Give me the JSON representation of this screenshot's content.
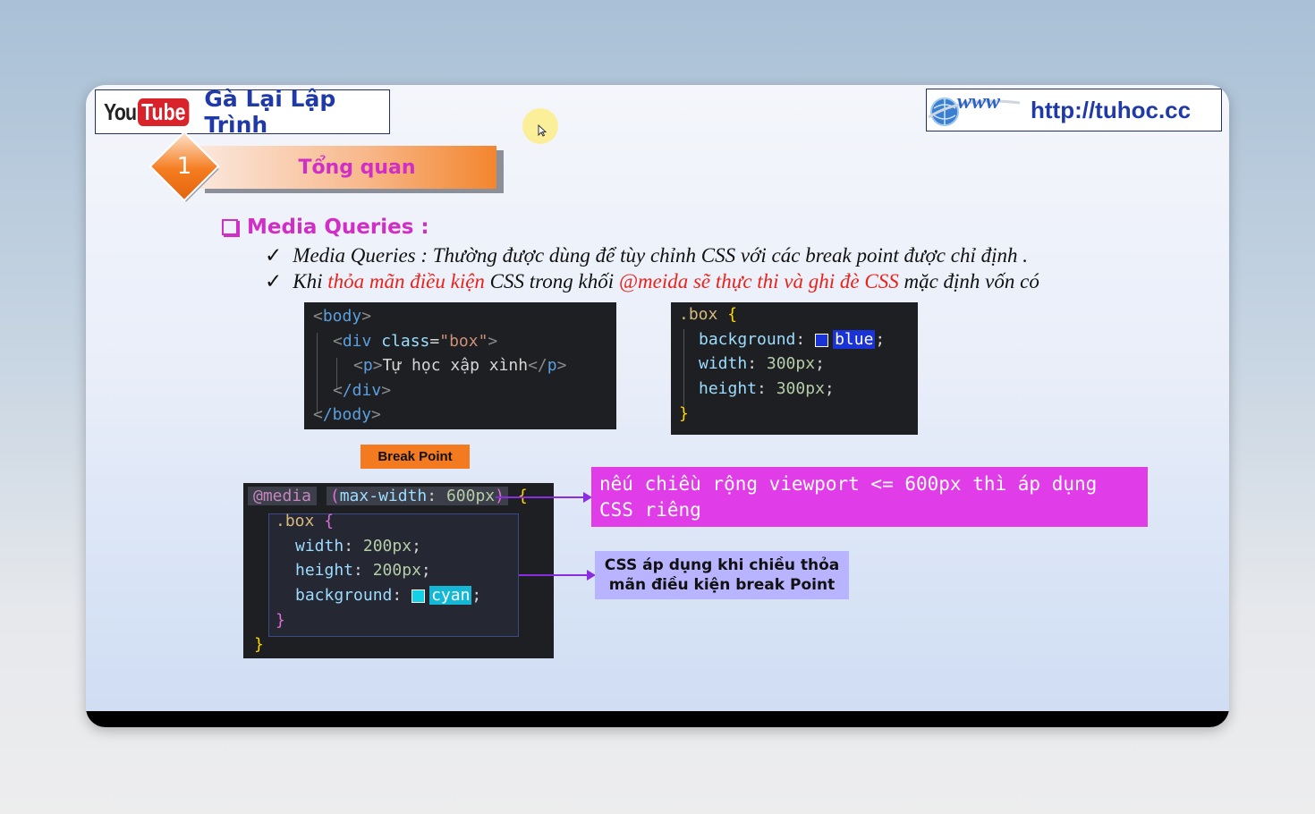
{
  "header": {
    "youtube_you": "You",
    "youtube_tube": "Tube",
    "channel_name": "Gà Lại Lập Trình",
    "www_text": "www",
    "website_url": "http://tuhoc.cc"
  },
  "section": {
    "number": "1",
    "title": "Tổng quan"
  },
  "content": {
    "heading": "Media Queries :",
    "bullet1": "Media Queries :  Thường được dùng để tùy chỉnh CSS với các break point được chỉ định .",
    "bullet2_part1": "Khi ",
    "bullet2_red1": "thỏa mãn điều kiện",
    "bullet2_part2": " CSS trong khối ",
    "bullet2_red2": "@meida sẽ thực thi và ghi đè CSS",
    "bullet2_part3": " mặc định vốn có"
  },
  "html_code": {
    "body_open": "body",
    "div_tag": "div",
    "class_attr": "class",
    "class_value": "\"box\"",
    "p_tag": "p",
    "p_text": "Tự học xập xình",
    "div_close": "/div",
    "body_close": "/body"
  },
  "css_code": {
    "selector": ".box",
    "prop_background": "background",
    "value_background": "blue",
    "prop_width": "width",
    "value_width": "300px",
    "prop_height": "height",
    "value_height": "300px",
    "swatch_color": "#1a33d6"
  },
  "media_code": {
    "at_rule": "@media",
    "condition_prop": "max-width",
    "condition_value": "600px",
    "selector": ".box",
    "prop_width": "width",
    "value_width": "200px",
    "prop_height": "height",
    "value_height": "200px",
    "prop_background": "background",
    "value_background": "cyan",
    "swatch_color": "#14d0e6"
  },
  "labels": {
    "break_point": "Break Point",
    "callout_viewport": "nếu chiều rộng viewport <= 600px thì áp dụng CSS riêng",
    "callout_css": "CSS áp dụng khi chiều thỏa mãn điều kiện break Point"
  },
  "colors": {
    "accent_magenta": "#d02ec6",
    "title_blue": "#1f3aa8",
    "highlight_red": "#e8231b",
    "callout_magenta": "#e03ce8",
    "callout_lavender": "#b9b4ff",
    "break_point_orange": "#f47a1f"
  }
}
